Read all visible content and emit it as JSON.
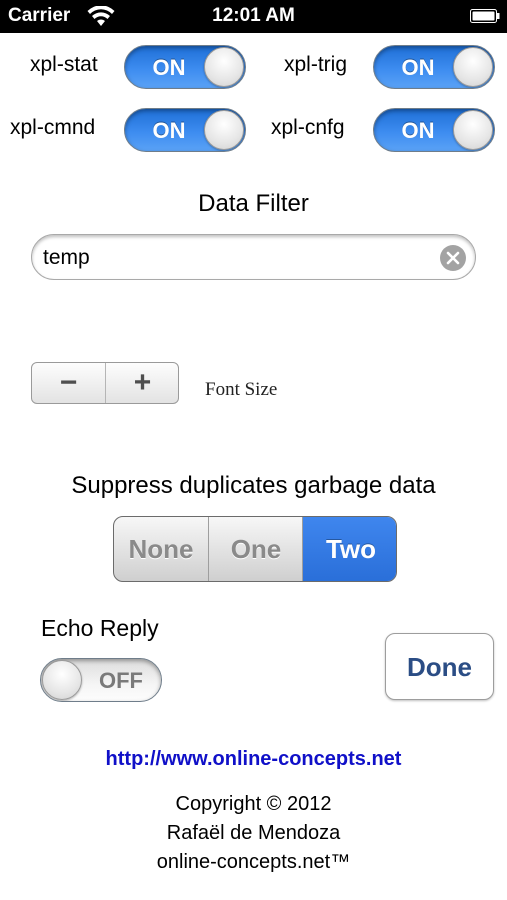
{
  "status_bar": {
    "carrier": "Carrier",
    "time": "12:01 AM",
    "icons": [
      "wifi-icon",
      "battery-icon"
    ]
  },
  "switches": [
    {
      "label": "xpl-stat",
      "state": "ON"
    },
    {
      "label": "xpl-trig",
      "state": "ON"
    },
    {
      "label": "xpl-cmnd",
      "state": "ON"
    },
    {
      "label": "xpl-cnfg",
      "state": "ON"
    }
  ],
  "data_filter": {
    "title": "Data Filter",
    "value": "temp",
    "clear_icon": "clear-icon"
  },
  "font_size": {
    "minus": "−",
    "plus": "+",
    "label": "Font Size"
  },
  "suppress": {
    "label": "Suppress duplicates garbage data",
    "options": [
      "None",
      "One",
      "Two"
    ],
    "selected": "Two"
  },
  "echo_reply": {
    "label": "Echo Reply",
    "state": "OFF"
  },
  "done_label": "Done",
  "footer": {
    "link": "http://www.online-concepts.net",
    "copyright": "Copyright © 2012",
    "author": "Rafaël de Mendoza",
    "site": "online-concepts.net™"
  },
  "colors": {
    "switch_on": "#3d8cf0",
    "segment_selected": "#2a6fd9",
    "link": "#1010c8",
    "done_text": "#2b4d85"
  }
}
